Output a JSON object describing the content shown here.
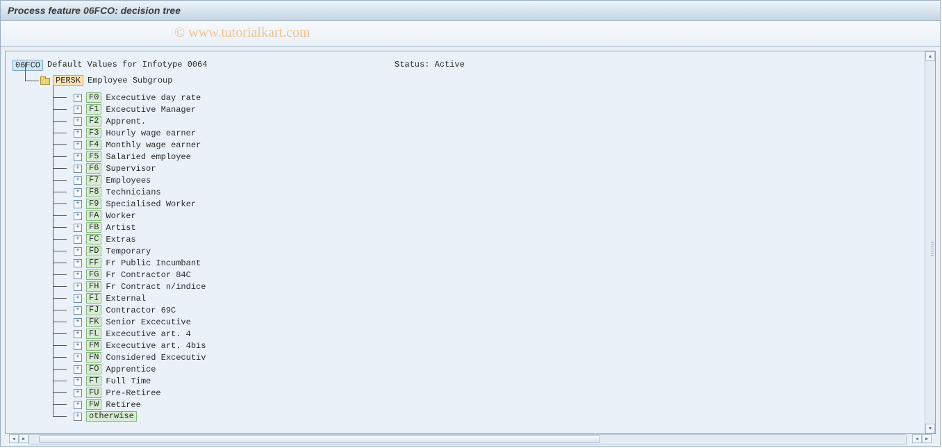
{
  "title": "Process feature 06FCO: decision tree",
  "watermark": "© www.tutorialkart.com",
  "root": {
    "code": "06FCO",
    "description": "Default Values for Infotype 0064"
  },
  "status_label": "Status:",
  "status_value": "Active",
  "group": {
    "code": "PERSK",
    "description": "Employee Subgroup"
  },
  "children": [
    {
      "code": "F0",
      "description": "Excecutive day rate"
    },
    {
      "code": "F1",
      "description": "Excecutive Manager"
    },
    {
      "code": "F2",
      "description": "Apprent."
    },
    {
      "code": "F3",
      "description": "Hourly wage earner"
    },
    {
      "code": "F4",
      "description": "Monthly wage earner"
    },
    {
      "code": "F5",
      "description": "Salaried employee"
    },
    {
      "code": "F6",
      "description": "Supervisor"
    },
    {
      "code": "F7",
      "description": "Employees"
    },
    {
      "code": "F8",
      "description": "Technicians"
    },
    {
      "code": "F9",
      "description": "Specialised Worker"
    },
    {
      "code": "FA",
      "description": "Worker"
    },
    {
      "code": "FB",
      "description": "Artist"
    },
    {
      "code": "FC",
      "description": "Extras"
    },
    {
      "code": "FD",
      "description": "Temporary"
    },
    {
      "code": "FF",
      "description": "Fr Public Incumbant"
    },
    {
      "code": "FG",
      "description": "Fr Contractor 84C"
    },
    {
      "code": "FH",
      "description": "Fr Contract n/indice"
    },
    {
      "code": "FI",
      "description": "External"
    },
    {
      "code": "FJ",
      "description": "Contractor 69C"
    },
    {
      "code": "FK",
      "description": "Senior Excecutive"
    },
    {
      "code": "FL",
      "description": "Excecutive art. 4"
    },
    {
      "code": "FM",
      "description": "Excecutive art. 4bis"
    },
    {
      "code": "FN",
      "description": "Considered Excecutiv"
    },
    {
      "code": "FO",
      "description": "Apprentice"
    },
    {
      "code": "FT",
      "description": "Full Time"
    },
    {
      "code": "FU",
      "description": "Pre-Retiree"
    },
    {
      "code": "FW",
      "description": "Retiree"
    },
    {
      "code": "otherwise",
      "description": ""
    }
  ]
}
